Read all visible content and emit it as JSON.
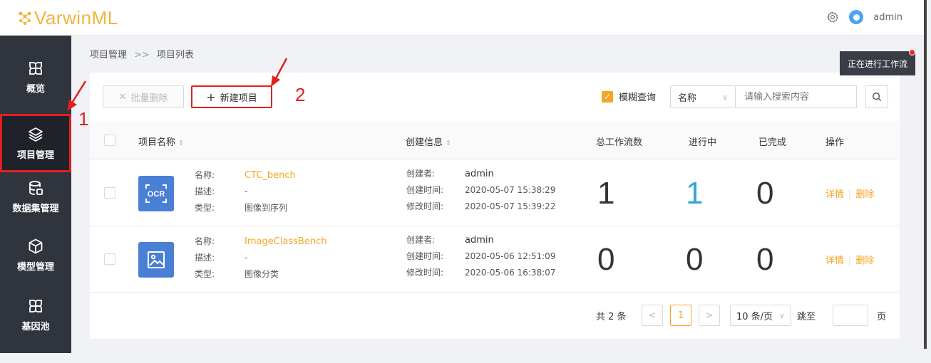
{
  "header": {
    "logo_text": "VarwinML",
    "username": "admin",
    "icons": {
      "settings": "gear-icon",
      "avatar": "avatar"
    }
  },
  "sidebar": {
    "items": [
      {
        "label": "概览",
        "icon": "grid-icon"
      },
      {
        "label": "项目管理",
        "icon": "layers-icon",
        "active": true
      },
      {
        "label": "数据集管理",
        "icon": "database-icon"
      },
      {
        "label": "模型管理",
        "icon": "cube-icon"
      },
      {
        "label": "基因池",
        "icon": "grid-icon"
      }
    ]
  },
  "breadcrumb": {
    "root": "项目管理",
    "sep": ">>",
    "current": "项目列表"
  },
  "running_workflows": {
    "label": "正在进行工作流"
  },
  "toolbar": {
    "batch_delete": "批量删除",
    "new_project": "新建项目",
    "fuzzy_label": "模糊查询",
    "fuzzy_checked": true,
    "select_value": "名称",
    "search_placeholder": "请输入搜索内容"
  },
  "annotations": {
    "one": "1",
    "two": "2"
  },
  "table": {
    "columns": {
      "name": "项目名称",
      "created": "创建信息",
      "total": "总工作流数",
      "running": "进行中",
      "done": "已完成",
      "ops": "操作"
    },
    "field_labels": {
      "name": "名称:",
      "desc": "描述:",
      "type": "类型:",
      "creator": "创建者:",
      "created_at": "创建时间:",
      "modified_at": "修改时间:"
    },
    "rows": [
      {
        "thumb": "ocr-icon",
        "thumb_text": "OCR",
        "name": "CTC_bench",
        "desc": "-",
        "type": "图像到序列",
        "creator": "admin",
        "created_at": "2020-05-07 15:38:29",
        "modified_at": "2020-05-07 15:39:22",
        "total": "1",
        "running": "1",
        "done": "0",
        "op_detail": "详情",
        "op_delete": "删除"
      },
      {
        "thumb": "image-icon",
        "name": "ImageClassBench",
        "desc": "-",
        "type": "图像分类",
        "creator": "admin",
        "created_at": "2020-05-06 12:51:09",
        "modified_at": "2020-05-06 16:38:07",
        "total": "0",
        "running": "0",
        "done": "0",
        "op_detail": "详情",
        "op_delete": "删除"
      }
    ]
  },
  "pagination": {
    "total_text": "共 2 条",
    "prev": "<",
    "current": "1",
    "next": ">",
    "page_size": "10 条/页",
    "jump_label": "跳至",
    "page_suffix": "页"
  },
  "colors": {
    "accent": "#f5a623",
    "annotation": "#e02020",
    "sidebar": "#30343c",
    "thumb": "#4a7fd6",
    "running": "#36a3d9"
  }
}
